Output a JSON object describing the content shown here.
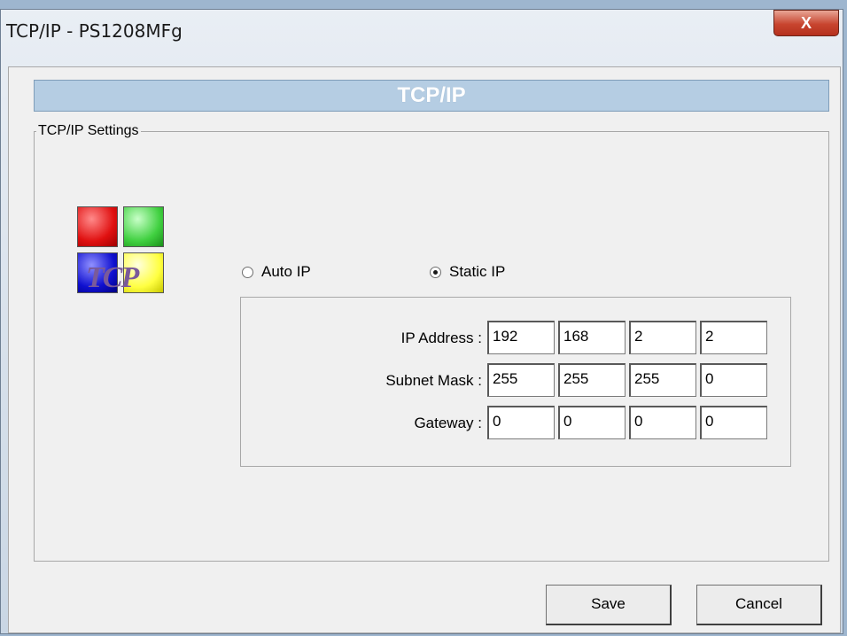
{
  "window": {
    "title": "TCP/IP - PS1208MFg",
    "close_label": "X"
  },
  "header": {
    "title": "TCP/IP"
  },
  "group": {
    "legend": "TCP/IP Settings",
    "logo_text": "TCP",
    "logo_colors": [
      "#e01010",
      "#40d040",
      "#1010d0",
      "#ffff40"
    ]
  },
  "mode": {
    "auto_label": "Auto IP",
    "static_label": "Static IP",
    "selected": "Static IP"
  },
  "fields": [
    {
      "label": "IP Address :",
      "octets": [
        "192",
        "168",
        "2",
        "2"
      ]
    },
    {
      "label": "Subnet Mask :",
      "octets": [
        "255",
        "255",
        "255",
        "0"
      ]
    },
    {
      "label": "Gateway :",
      "octets": [
        "0",
        "0",
        "0",
        "0"
      ]
    }
  ],
  "buttons": {
    "save_label": "Save",
    "cancel_label": "Cancel"
  }
}
